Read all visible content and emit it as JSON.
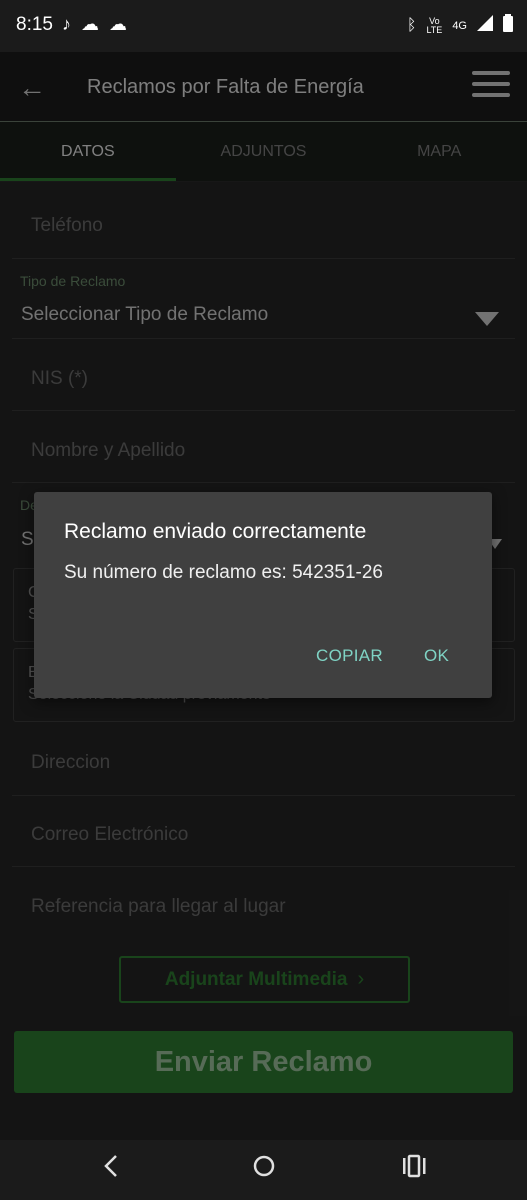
{
  "status_bar": {
    "time": "8:15",
    "icons_left": [
      "tiktok-icon",
      "cloud-outline-icon",
      "cloud-icon"
    ],
    "icons_right": [
      "bluetooth-icon",
      "volte-icon",
      "4g-icon",
      "signal-icon",
      "battery-icon"
    ],
    "volte_top": "Vo",
    "volte_bottom": "LTE",
    "net_label": "4G"
  },
  "app_bar": {
    "title": "Reclamos por Falta de Energía"
  },
  "tabs": [
    {
      "label": "DATOS",
      "active": true
    },
    {
      "label": "ADJUNTOS",
      "active": false
    },
    {
      "label": "MAPA",
      "active": false
    }
  ],
  "form": {
    "telefono_placeholder": "Teléfono",
    "tipo_label": "Tipo de Reclamo",
    "tipo_value": "Seleccionar Tipo de Reclamo",
    "nis_placeholder": "NIS (*)",
    "nombre_placeholder": "Nombre y Apellido",
    "dept_label_partial": "De",
    "dept_value_partial": "S",
    "ciudad_label_partial": "C",
    "ciudad_value_partial": "S",
    "barrio_label_partial": "B",
    "barrio_hint": "Seleccione la Ciudad previamente",
    "direccion_placeholder": "Direccion",
    "correo_placeholder": "Correo Electrónico",
    "referencia_placeholder": "Referencia para llegar al lugar",
    "adjuntar_label": "Adjuntar Multimedia",
    "enviar_label": "Enviar Reclamo"
  },
  "dialog": {
    "title": "Reclamo enviado correctamente",
    "message": "Su número de reclamo es: 542351-26",
    "copy_button": "COPIAR",
    "ok_button": "OK"
  },
  "colors": {
    "accent_green": "#2f7d32",
    "dialog_button": "#7fd3c4"
  }
}
